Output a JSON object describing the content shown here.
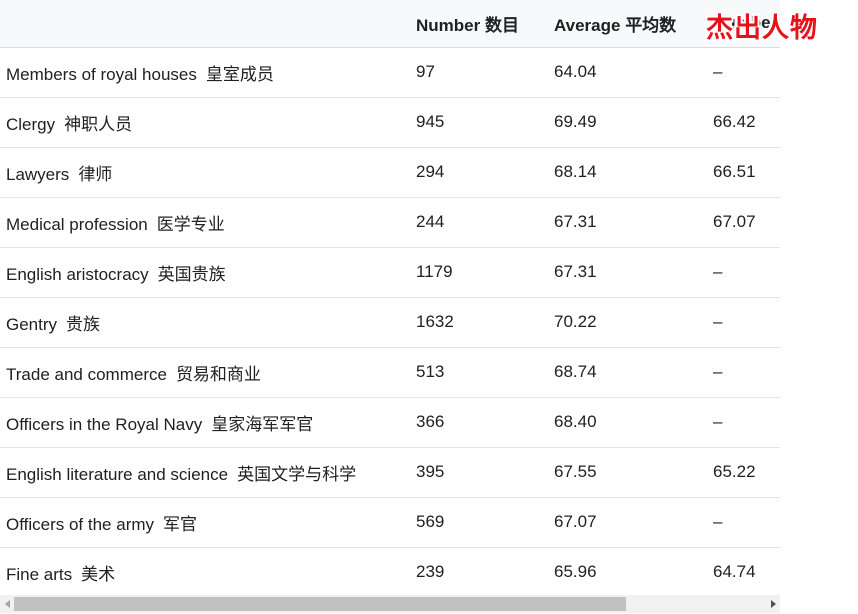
{
  "table": {
    "headers": {
      "category": "",
      "number": "Number 数目",
      "average": "Average 平均数",
      "extra": "Number"
    },
    "rows": [
      {
        "en": "Members of royal houses",
        "zh": "皇室成员",
        "number": "97",
        "average": "64.04",
        "extra": "–"
      },
      {
        "en": "Clergy",
        "zh": "神职人员",
        "number": "945",
        "average": "69.49",
        "extra": "66.42"
      },
      {
        "en": "Lawyers",
        "zh": "律师",
        "number": "294",
        "average": "68.14",
        "extra": "66.51"
      },
      {
        "en": "Medical profession",
        "zh": "医学专业",
        "number": "244",
        "average": "67.31",
        "extra": "67.07"
      },
      {
        "en": "English aristocracy",
        "zh": "英国贵族",
        "number": "1179",
        "average": "67.31",
        "extra": "–"
      },
      {
        "en": "Gentry",
        "zh": "贵族",
        "number": "1632",
        "average": "70.22",
        "extra": "–"
      },
      {
        "en": "Trade and commerce",
        "zh": "贸易和商业",
        "number": "513",
        "average": "68.74",
        "extra": "–"
      },
      {
        "en": "Officers in the Royal Navy",
        "zh": "皇家海军军官",
        "number": "366",
        "average": "68.40",
        "extra": "–"
      },
      {
        "en": "English literature and science",
        "zh": "英国文学与科学",
        "number": "395",
        "average": "67.55",
        "extra": "65.22"
      },
      {
        "en": "Officers of the army",
        "zh": "军官",
        "number": "569",
        "average": "67.07",
        "extra": "–"
      },
      {
        "en": "Fine arts",
        "zh": "美术",
        "number": "239",
        "average": "65.96",
        "extra": "64.74"
      }
    ]
  },
  "overlay": {
    "title": "杰出人物",
    "color": "#e8101b"
  },
  "scrollbar": {
    "left_icon": "arrow-left-icon",
    "right_icon": "arrow-right-icon"
  }
}
